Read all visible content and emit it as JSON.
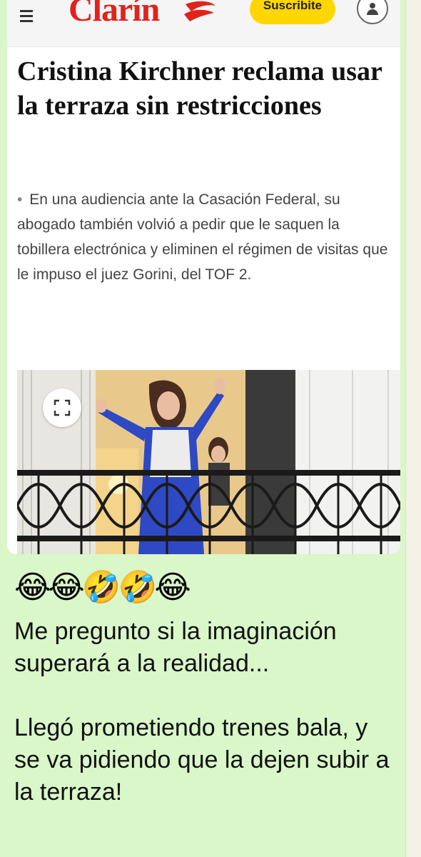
{
  "header": {
    "menu_icon": "hamburger-icon",
    "logo_text": "Clarín",
    "logo_mark_icon": "clarin-mark-icon",
    "subscribe_label": "Suscribite",
    "account_icon": "user-icon",
    "brand_color": "#e0231d",
    "subscribe_color": "#ffd600"
  },
  "article": {
    "headline": "Cristina Kirchner reclama usar la terraza sin restricciones",
    "bullet": "•",
    "summary": "En una audiencia ante la Casación Federal, su abogado también volvió a pedir que le saquen la tobillera electrónica y eliminen el régimen de visitas que le impuso el juez Gorini, del TOF 2.",
    "image_description_icon": "expand-icon"
  },
  "message": {
    "emojis": "😂😂🤣🤣😂",
    "text": "Me pregunto si la imaginación superará a la realidad...\n\nLlegó prometiendo trenes bala, y se va pidiendo que la dejen subir a la terraza!"
  }
}
